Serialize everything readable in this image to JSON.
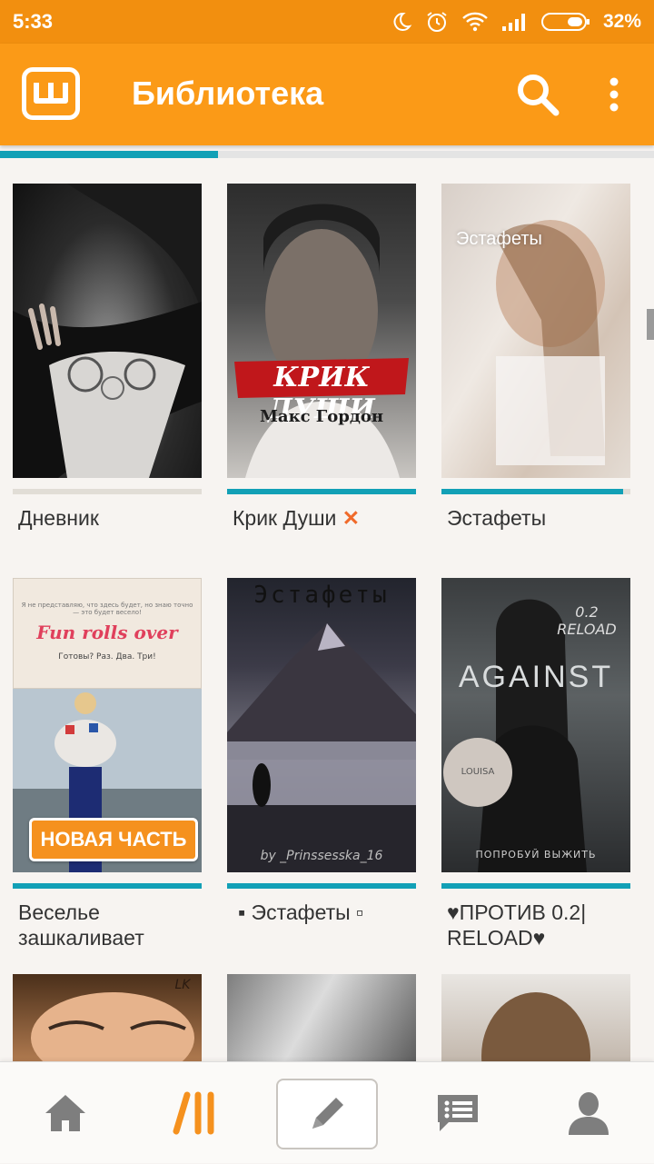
{
  "status_bar": {
    "time": "5:33",
    "battery": "32%"
  },
  "app_bar": {
    "logo_letter": "ш",
    "title": "Библиотека"
  },
  "colors": {
    "accent": "#fb9a17",
    "progress": "#12a0b6"
  },
  "stories": [
    {
      "title": "Дневник",
      "progress": 0
    },
    {
      "title": "Крик Души",
      "title_suffix": "✕",
      "progress": 1.0,
      "cover_title": "КРИК ДУШИ",
      "cover_author": "Макс Гордон"
    },
    {
      "title": "Эстафеты",
      "progress": 0.96,
      "cover_title": "Эстафеты"
    },
    {
      "title": "Веселье зашкаливает",
      "progress": 1.0,
      "badge": "НОВАЯ ЧАСТЬ",
      "cover_title": "Fun rolls over",
      "cover_sub": "Готовы? Раз. Два. Три!",
      "cover_top": "Я не представляю, что здесь будет, но знаю точно — это будет весело!"
    },
    {
      "title": "▪ Эстафеты ▫",
      "progress": 1.0,
      "cover_title": "Эстафеты",
      "cover_author": "by _Prinssesska_16"
    },
    {
      "title": "♥ПРОТИВ 0.2| RELOAD♥",
      "progress": 1.0,
      "cover_title": "AGAINST",
      "cover_sub": "0.2 RELOAD",
      "cover_author": "ПОПРОБУЙ ВЫЖИТЬ",
      "cover_stamp": "LOUISA"
    },
    {
      "title": "",
      "progress": 0,
      "cover_mark": "LK"
    },
    {
      "title": "",
      "progress": 0
    },
    {
      "title": "",
      "progress": 0
    }
  ],
  "bottom_nav": {
    "items": [
      {
        "name": "home",
        "icon": "home-icon"
      },
      {
        "name": "library",
        "icon": "library-icon"
      },
      {
        "name": "write",
        "icon": "pencil-icon"
      },
      {
        "name": "messages",
        "icon": "messages-icon"
      },
      {
        "name": "profile",
        "icon": "profile-icon"
      }
    ]
  }
}
